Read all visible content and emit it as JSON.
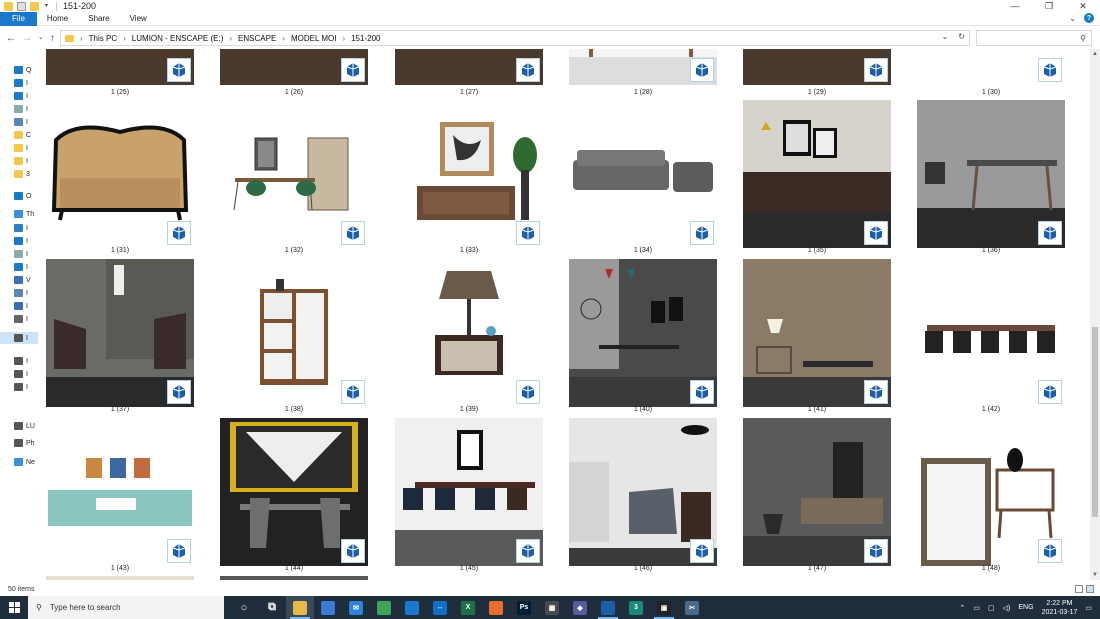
{
  "window": {
    "title": "151-200",
    "controls": [
      "—",
      "❐",
      "✕"
    ]
  },
  "ribbon": {
    "tabs": [
      "File",
      "Home",
      "Share",
      "View"
    ],
    "expand_icon": "chevron-down-icon",
    "help_label": "?"
  },
  "address": {
    "crumbs": [
      "This PC",
      "LUMION - ENSCAPE (E:)",
      "ENSCAPE",
      "MODEL MOI",
      "151-200"
    ],
    "search_placeholder": ""
  },
  "navpane": {
    "quick_access_label": "Q",
    "onedrive_label": "O",
    "thispc_label": "Th",
    "lumion_label": "LU",
    "photos_label": "Ph",
    "network_label": "Ne",
    "items": [
      "I",
      "I",
      "I",
      "I",
      "C",
      "I",
      "I",
      "3",
      "I",
      "I",
      "I",
      "I",
      "V",
      "I",
      "I",
      "I",
      "I",
      "I",
      "I",
      "I"
    ]
  },
  "items": [
    {
      "label": "1 (25)",
      "scene": "table-dark-top"
    },
    {
      "label": "1 (26)",
      "scene": "table-dark-top"
    },
    {
      "label": "1 (27)",
      "scene": "table-dark-top"
    },
    {
      "label": "1 (28)",
      "scene": "console-top"
    },
    {
      "label": "1 (29)",
      "scene": "table-dark-top"
    },
    {
      "label": "1 (30)",
      "scene": "chairs-top"
    },
    {
      "label": "1 (31)",
      "scene": "sofa-gold"
    },
    {
      "label": "1 (32)",
      "scene": "desk-set"
    },
    {
      "label": "1 (33)",
      "scene": "sideboard-art"
    },
    {
      "label": "1 (34)",
      "scene": "grey-sofa"
    },
    {
      "label": "1 (35)",
      "scene": "sideboard-room"
    },
    {
      "label": "1 (36)",
      "scene": "dining-grey"
    },
    {
      "label": "1 (37)",
      "scene": "armchairs-room"
    },
    {
      "label": "1 (38)",
      "scene": "cabinet"
    },
    {
      "label": "1 (39)",
      "scene": "lamp-nightstand"
    },
    {
      "label": "1 (40)",
      "scene": "dining-room-dark"
    },
    {
      "label": "1 (41)",
      "scene": "lounge-pattern"
    },
    {
      "label": "1 (42)",
      "scene": "dining-black"
    },
    {
      "label": "1 (43)",
      "scene": "teal-sofa-set"
    },
    {
      "label": "1 (44)",
      "scene": "dining-art-wall"
    },
    {
      "label": "1 (45)",
      "scene": "bar-stools"
    },
    {
      "label": "1 (46)",
      "scene": "armchair-marble"
    },
    {
      "label": "1 (47)",
      "scene": "tv-console"
    },
    {
      "label": "1 (48)",
      "scene": "mirror-nightstand"
    }
  ],
  "status": {
    "count": "50 items"
  },
  "taskbar": {
    "search_placeholder": "Type here to search",
    "apps": [
      "search-ring-icon",
      "task-view-icon",
      "file-explorer-icon",
      "store-icon",
      "mail-icon",
      "chrome-icon",
      "photos-icon",
      "teamviewer-icon",
      "excel-icon",
      "app-icon",
      "photoshop-icon",
      "calculator-icon",
      "shield-app-icon",
      "sketchup-icon",
      "3dsmax-icon",
      "terminal-icon",
      "snip-icon"
    ],
    "lang": "ENG",
    "time": "2:22 PM",
    "date": "2021-03-17"
  },
  "colors": {
    "accent": "#1979ca",
    "taskbar": "#1f2d3d",
    "sketchup_blue": "#1a5fa8"
  }
}
